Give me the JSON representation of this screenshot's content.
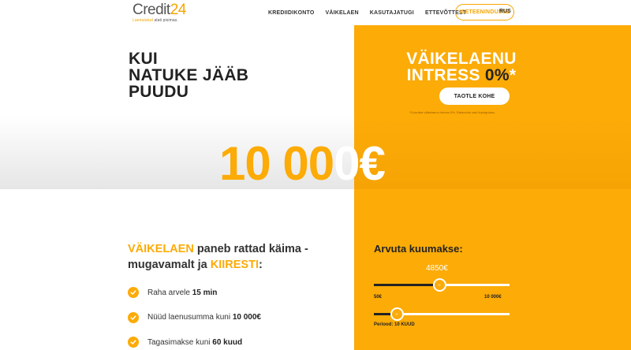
{
  "header": {
    "logo_main": "Credit",
    "logo_accent": "24",
    "logo_tag_accent": "Laenutatud ",
    "logo_tag_rest": "alati pisimas.",
    "nav": [
      "KREDIIDIKONTO",
      "VÄIKELAEN",
      "KASUTAJATUGI",
      "ETTEVÕTTEST"
    ],
    "cta": "ISETEENINDUSSE",
    "lang": "RUS"
  },
  "hero": {
    "title_lines": [
      "KUI",
      "NATUKE JÄÄB",
      "PUUDU"
    ],
    "promo_line1": "VÄIKELAENU",
    "promo_line2_a": "INTRESS ",
    "promo_line2_b": "0%",
    "promo_line2_c": "*",
    "promo_button": "TAOTLE KOHE",
    "promo_note": "*3-kuulise väikelaenu intress 0%. Rakendub vaid lepingutasu.",
    "amount_left": "10 00",
    "amount_right": "0€"
  },
  "features": {
    "title_acc1": "VÄIKELAEN",
    "title_rest1": " paneb rattad käima -",
    "title_rest2": "mugavamalt ja ",
    "title_acc2": "KIIRESTI",
    "title_end": ":",
    "items": [
      {
        "text": "Raha arvele ",
        "bold": "15 min"
      },
      {
        "text": "Nüüd laenusumma kuni ",
        "bold": "10 000€"
      },
      {
        "text": "Tagasimakse kuni ",
        "bold": "60 kuud"
      }
    ]
  },
  "calculator": {
    "title": "Arvuta kuumakse:",
    "amount_value": "4850€",
    "amount_min": "50€",
    "amount_max": "10 000€",
    "amount_fraction": 0.485,
    "thumb_symbol": "‹›",
    "period_label": "Periood: 10 KUUD",
    "period_fraction": 0.17
  },
  "colors": {
    "accent": "#fcab07",
    "dark": "#222222"
  }
}
